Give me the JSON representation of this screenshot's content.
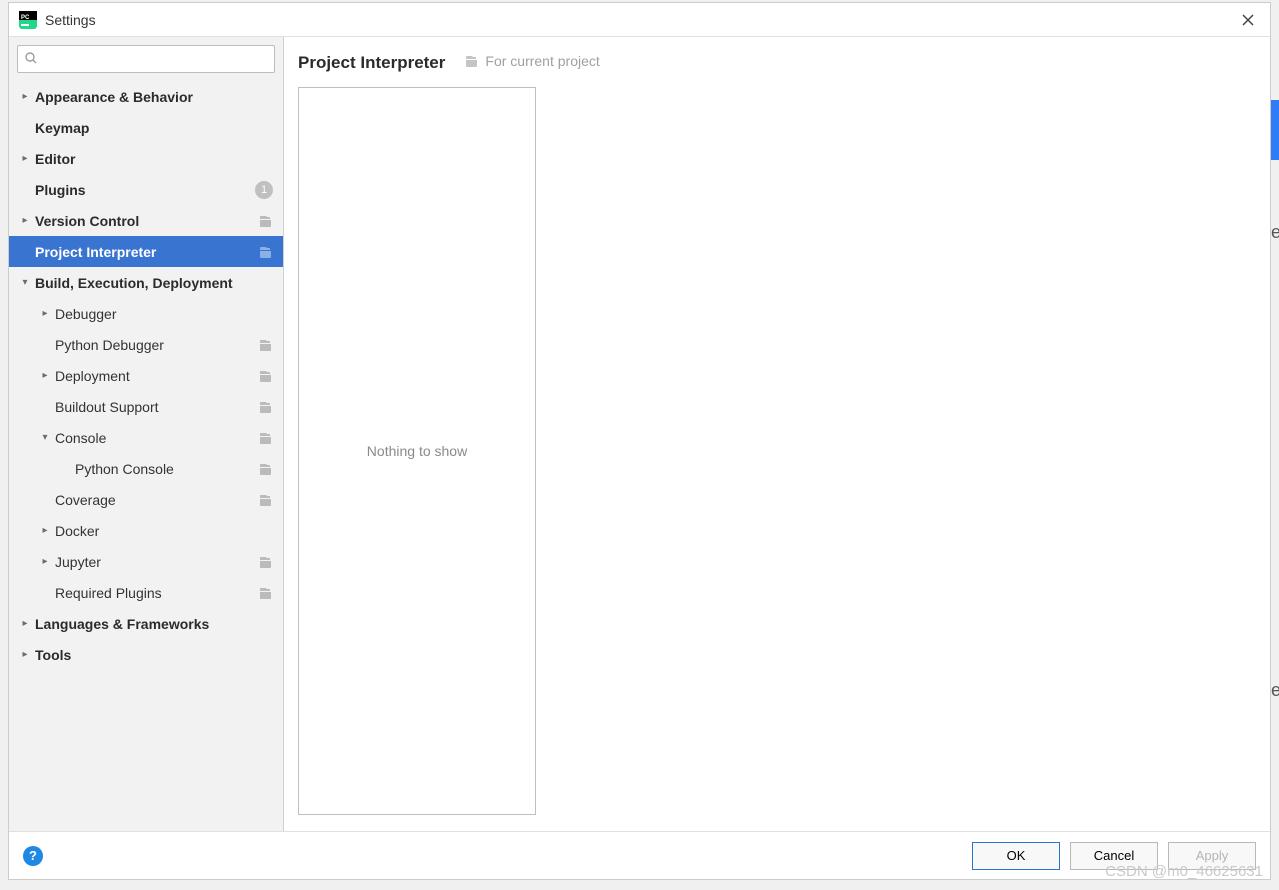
{
  "window": {
    "title": "Settings"
  },
  "search": {
    "placeholder": ""
  },
  "sidebar": {
    "items": [
      {
        "label": "Appearance & Behavior",
        "depth": 0,
        "chev": "right",
        "bold": true,
        "badge": null,
        "scope": false,
        "selected": false
      },
      {
        "label": "Keymap",
        "depth": 0,
        "chev": "",
        "bold": true,
        "badge": null,
        "scope": false,
        "selected": false
      },
      {
        "label": "Editor",
        "depth": 0,
        "chev": "right",
        "bold": true,
        "badge": null,
        "scope": false,
        "selected": false
      },
      {
        "label": "Plugins",
        "depth": 0,
        "chev": "",
        "bold": true,
        "badge": "1",
        "scope": false,
        "selected": false
      },
      {
        "label": "Version Control",
        "depth": 0,
        "chev": "right",
        "bold": true,
        "badge": null,
        "scope": true,
        "selected": false
      },
      {
        "label": "Project Interpreter",
        "depth": 0,
        "chev": "",
        "bold": true,
        "badge": null,
        "scope": true,
        "selected": true
      },
      {
        "label": "Build, Execution, Deployment",
        "depth": 0,
        "chev": "down",
        "bold": true,
        "badge": null,
        "scope": false,
        "selected": false
      },
      {
        "label": "Debugger",
        "depth": 1,
        "chev": "right",
        "bold": false,
        "badge": null,
        "scope": false,
        "selected": false
      },
      {
        "label": "Python Debugger",
        "depth": 1,
        "chev": "",
        "bold": false,
        "badge": null,
        "scope": true,
        "selected": false
      },
      {
        "label": "Deployment",
        "depth": 1,
        "chev": "right",
        "bold": false,
        "badge": null,
        "scope": true,
        "selected": false
      },
      {
        "label": "Buildout Support",
        "depth": 1,
        "chev": "",
        "bold": false,
        "badge": null,
        "scope": true,
        "selected": false
      },
      {
        "label": "Console",
        "depth": 1,
        "chev": "down",
        "bold": false,
        "badge": null,
        "scope": true,
        "selected": false
      },
      {
        "label": "Python Console",
        "depth": 2,
        "chev": "",
        "bold": false,
        "badge": null,
        "scope": true,
        "selected": false
      },
      {
        "label": "Coverage",
        "depth": 1,
        "chev": "",
        "bold": false,
        "badge": null,
        "scope": true,
        "selected": false
      },
      {
        "label": "Docker",
        "depth": 1,
        "chev": "right",
        "bold": false,
        "badge": null,
        "scope": false,
        "selected": false
      },
      {
        "label": "Jupyter",
        "depth": 1,
        "chev": "right",
        "bold": false,
        "badge": null,
        "scope": true,
        "selected": false
      },
      {
        "label": "Required Plugins",
        "depth": 1,
        "chev": "",
        "bold": false,
        "badge": null,
        "scope": true,
        "selected": false
      },
      {
        "label": "Languages & Frameworks",
        "depth": 0,
        "chev": "right",
        "bold": true,
        "badge": null,
        "scope": false,
        "selected": false
      },
      {
        "label": "Tools",
        "depth": 0,
        "chev": "right",
        "bold": true,
        "badge": null,
        "scope": false,
        "selected": false
      }
    ]
  },
  "main": {
    "title": "Project Interpreter",
    "scope_label": "For current project",
    "empty_text": "Nothing to show"
  },
  "footer": {
    "help": "?",
    "ok": "OK",
    "cancel": "Cancel",
    "apply": "Apply"
  },
  "watermark": "CSDN @m0_46625631"
}
